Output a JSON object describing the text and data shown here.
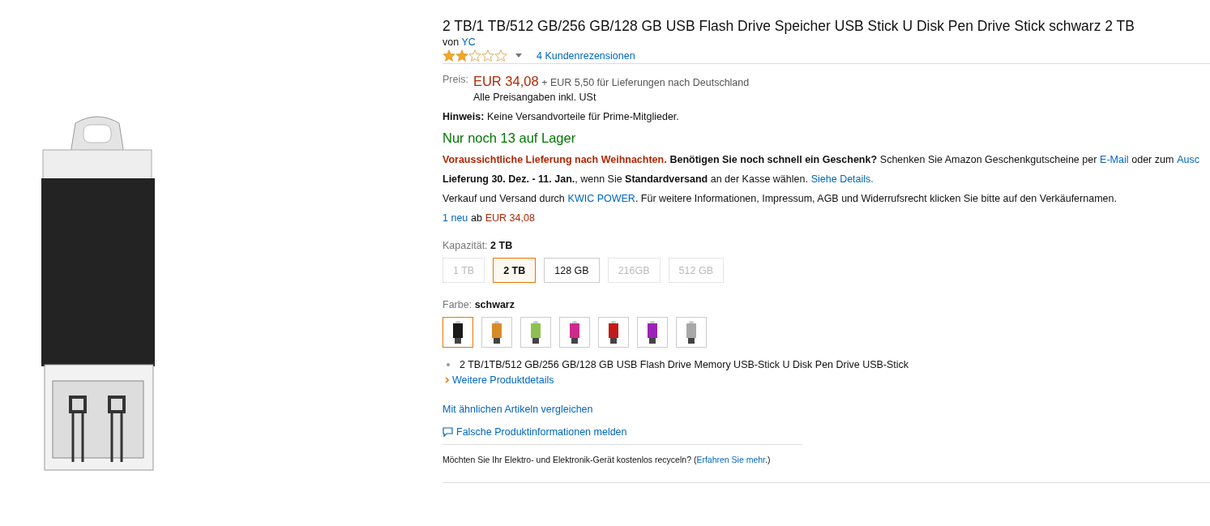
{
  "product": {
    "title": "2 TB/1 TB/512 GB/256 GB/128 GB USB Flash Drive Speicher USB Stick U Disk Pen Drive Stick schwarz 2 TB",
    "brand_prefix": "von",
    "brand": "YC",
    "stars": 2,
    "reviews": "4 Kundenrezensionen"
  },
  "price": {
    "label": "Preis:",
    "amount": "EUR 34,08",
    "shipping_prefix": "+",
    "shipping": "EUR 5,50 für Lieferungen nach Deutschland",
    "vat": "Alle Preisangaben inkl. USt"
  },
  "notice": {
    "label": "Hinweis:",
    "text": "Keine Versandvorteile für Prime-Mitglieder."
  },
  "stock": "Nur noch 13 auf Lager",
  "lines": [
    [
      {
        "kind": "alert",
        "text": "Voraussichtliche Lieferung nach Weihnachten."
      },
      {
        "kind": "bold",
        "text": "Benötigen Sie noch schnell ein Geschenk?"
      },
      {
        "kind": "text",
        "text": "Schenken Sie Amazon Geschenkgutscheine per"
      },
      {
        "kind": "link",
        "text": "E-Mail"
      },
      {
        "kind": "text",
        "text": "oder zum"
      },
      {
        "kind": "link",
        "text": "Ausc"
      }
    ],
    [
      {
        "kind": "text",
        "text": "**Lieferung 30. Dez. - 11. Jan.**, wenn Sie **Standardversand** an der Kasse wählen."
      },
      {
        "kind": "link",
        "text": "Siehe Details."
      }
    ],
    [
      {
        "kind": "text",
        "text": "Verkauf und Versand durch"
      },
      {
        "kind": "link",
        "text": "KWIC POWER"
      },
      {
        "kind": "text",
        "text": ". Für weitere Informationen, Impressum, AGB und Widerrufsrecht klicken Sie bitte auf den Verkäufernamen."
      }
    ],
    [
      {
        "kind": "link",
        "text": "1 neu"
      },
      {
        "kind": "text",
        "text": "ab"
      },
      {
        "kind": "price",
        "text": "EUR 34,08"
      }
    ]
  ],
  "capacity": {
    "label": "Kapazität:",
    "value": "2 TB",
    "options": [
      {
        "label": "1 TB",
        "selected": false,
        "disabled": true
      },
      {
        "label": "2 TB",
        "selected": true,
        "disabled": false
      },
      {
        "label": "128 GB",
        "selected": false,
        "disabled": false
      },
      {
        "label": "216GB",
        "selected": false,
        "disabled": true
      },
      {
        "label": "512 GB",
        "selected": false,
        "disabled": true
      }
    ]
  },
  "color_choice": {
    "label": "Farbe:",
    "value": "schwarz",
    "swatches": [
      {
        "color": "#1a1a1a",
        "selected": true
      },
      {
        "color": "#d88a2a",
        "selected": false
      },
      {
        "color": "#8cc152",
        "selected": false
      },
      {
        "color": "#cc2b8c",
        "selected": false
      },
      {
        "color": "#c41a1a",
        "selected": false
      },
      {
        "color": "#9b22b8",
        "selected": false
      },
      {
        "color": "#a8a8a8",
        "selected": false
      }
    ]
  },
  "bullets": [
    "2 TB/1TB/512 GB/256 GB/128 GB USB Flash Drive Memory USB-Stick U Disk Pen Drive USB-Stick"
  ],
  "more_details": "Weitere Produktdetails",
  "compare": "Mit ähnlichen Artikeln vergleichen",
  "report": "Falsche Produktinformationen melden",
  "recycle": {
    "text": "Möchten Sie Ihr Elektro- und Elektronik-Gerät kostenlos recyceln? (",
    "link": "Erfahren Sie mehr",
    "after": ".)"
  }
}
